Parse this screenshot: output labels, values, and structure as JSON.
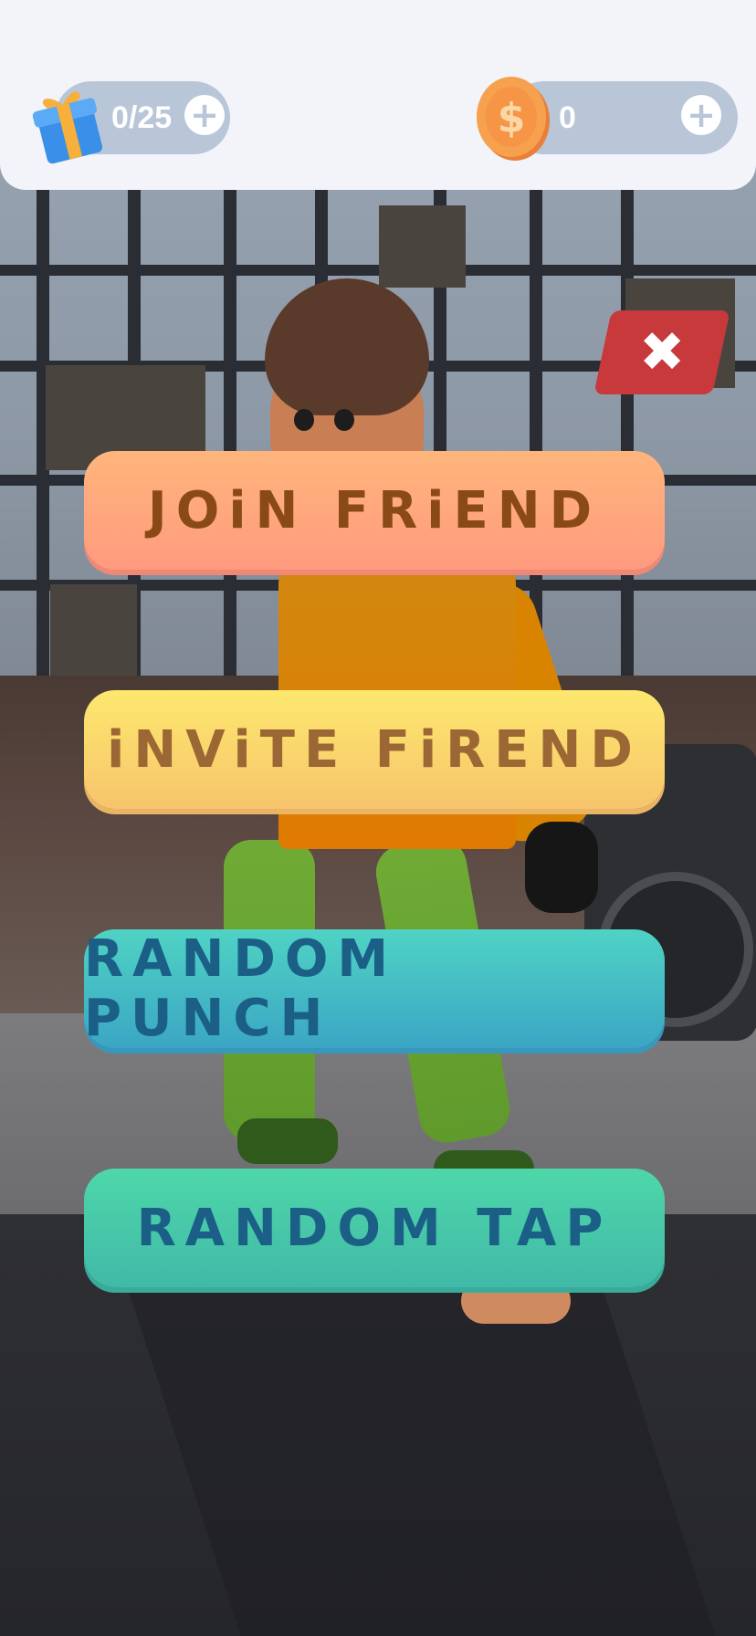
{
  "hud": {
    "gift_counter": "0/25",
    "coin_counter": "0",
    "gift_icon": "gift-box-icon",
    "coin_icon": "dollar-coin-icon",
    "plus_icon": "plus-icon"
  },
  "close_button": {
    "icon": "close-x-icon",
    "glyph": "✖"
  },
  "menu": {
    "join_friend": "JOiN FRiEND",
    "invite_friend": "iNViTE FiREND",
    "random_punch": "RANDOM PUNCH",
    "random_tap": "RANDOM TAP"
  },
  "colors": {
    "join": "#ff9f7e",
    "invite": "#f9d46c",
    "punch": "#44bec5",
    "tap": "#46c9a8",
    "close": "#c8393c",
    "pill": "#b8c6d8"
  }
}
